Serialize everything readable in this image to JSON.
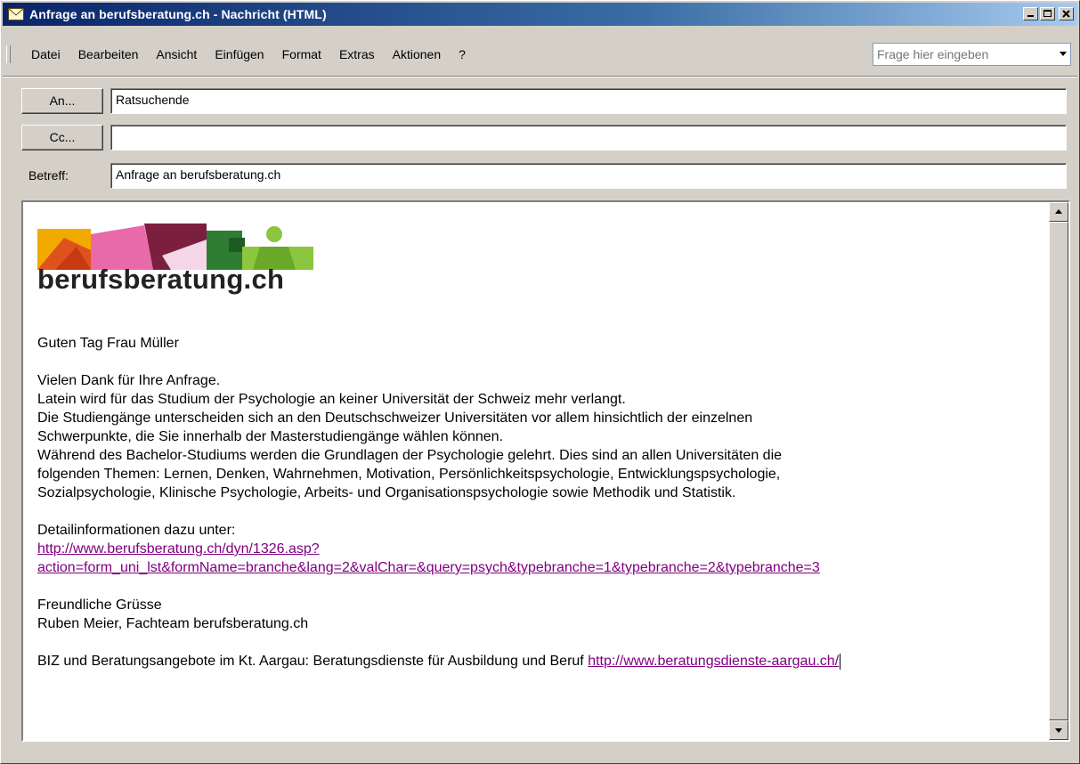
{
  "window": {
    "title": "Anfrage an berufsberatung.ch - Nachricht (HTML)",
    "icon": "envelope-icon",
    "controls": [
      "minimize-icon",
      "maximize-icon",
      "close-icon"
    ]
  },
  "menu": {
    "items": [
      "Datei",
      "Bearbeiten",
      "Ansicht",
      "Einfügen",
      "Format",
      "Extras",
      "Aktionen",
      "?"
    ],
    "help_placeholder": "Frage hier eingeben"
  },
  "header": {
    "to_button": "An...",
    "to_value": "Ratsuchende",
    "cc_button": "Cc...",
    "cc_value": "",
    "subject_label": "Betreff:",
    "subject_value": "Anfrage an berufsberatung.ch"
  },
  "body": {
    "logo_text": "berufsberatung.ch",
    "logo_colors": [
      "#f2a900",
      "#e0521c",
      "#e96aa8",
      "#7c1f3f",
      "#2f7d32",
      "#8cc63f"
    ],
    "greeting": "Guten Tag Frau Müller",
    "paragraph_lines": [
      "Vielen Dank für Ihre Anfrage.",
      "Latein wird für das Studium der Psychologie an keiner Universität der Schweiz mehr verlangt.",
      "Die Studiengänge unterscheiden sich an den Deutschschweizer Universitäten vor allem hinsichtlich der einzelnen",
      "Schwerpunkte, die Sie innerhalb der Masterstudiengänge wählen können.",
      "Während des Bachelor-Studiums werden die Grundlagen der Psychologie gelehrt. Dies sind an allen Universitäten die",
      "folgenden Themen: Lernen, Denken, Wahrnehmen, Motivation, Persönlichkeitspsychologie, Entwicklungspsychologie,",
      "Sozialpsychologie, Klinische Psychologie, Arbeits- und Organisationspsychologie sowie Methodik und Statistik."
    ],
    "details_label": "Detailinformationen dazu unter:",
    "details_link_line1": "http://www.berufsberatung.ch/dyn/1326.asp?",
    "details_link_line2": "action=form_uni_lst&formName=branche&lang=2&valChar=&query=psych&typebranche=1&typebranche=2&typebranche=3",
    "closing": "Freundliche Grüsse",
    "signature": "Ruben Meier, Fachteam berufsberatung.ch",
    "footer_text": "BIZ und Beratungsangebote im Kt. Aargau: Beratungsdienste für Ausbildung und Beruf ",
    "footer_link": "http://www.beratungsdienste-aargau.ch/"
  },
  "colors": {
    "titlebar_start": "#0a246a",
    "titlebar_end": "#a6caf0",
    "link": "#800080",
    "chrome": "#d4d0c8"
  }
}
